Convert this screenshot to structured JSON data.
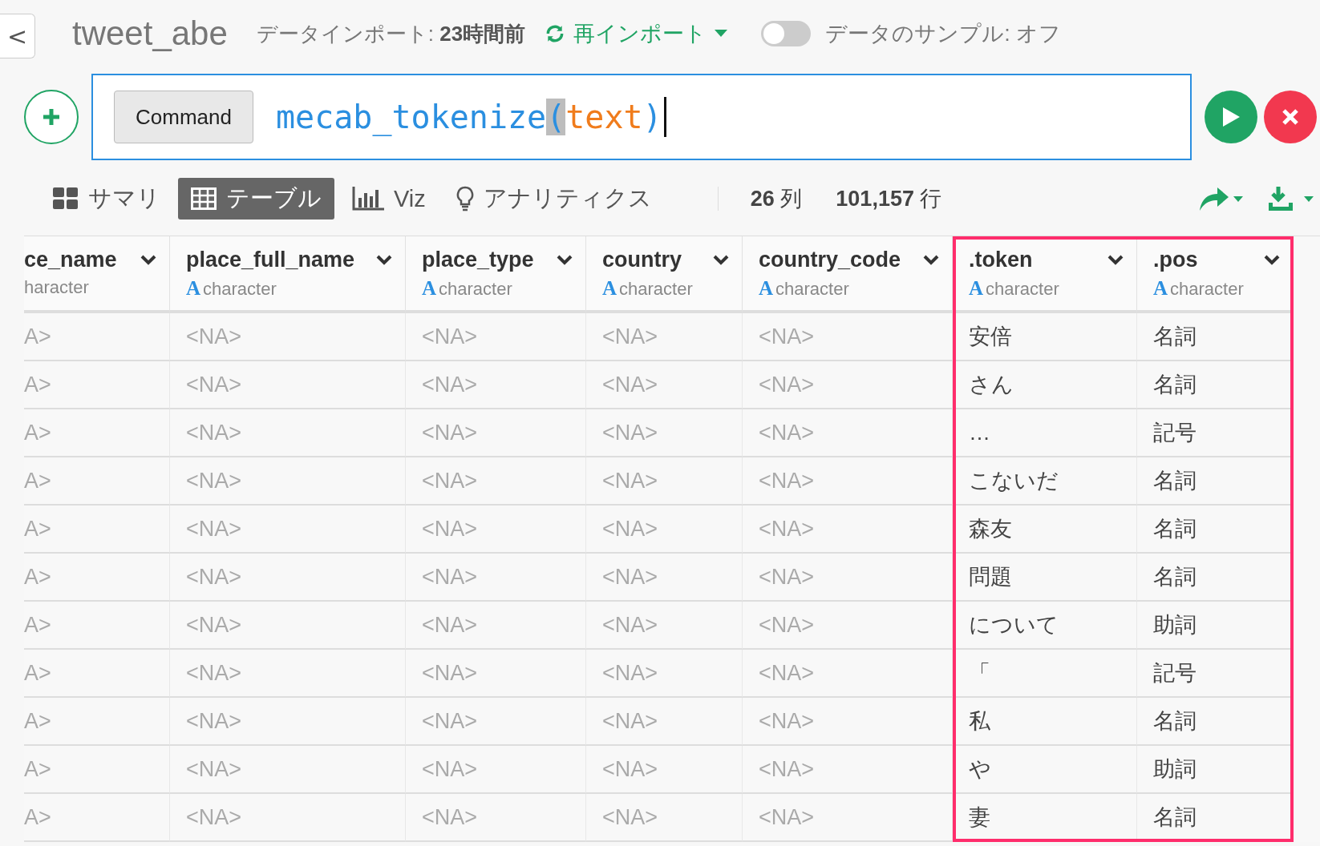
{
  "header": {
    "back": "<",
    "title": "tweet_abe",
    "import_info": "データインポート: **23時間前**",
    "reimport": "再インポート",
    "sample_toggle": {
      "on": false,
      "label": "データのサンプル: オフ"
    }
  },
  "command": {
    "button": "Command",
    "tokens": [
      {
        "text": "mecab_tokenize",
        "kind": "func",
        "highlighted": false
      },
      {
        "text": "(",
        "kind": "paren",
        "highlighted": true
      },
      {
        "text": "text",
        "kind": "arg",
        "highlighted": false
      },
      {
        "text": ")",
        "kind": "paren",
        "highlighted": false
      }
    ]
  },
  "views": [
    {
      "label": "サマリ",
      "kind": "summary",
      "selected": false
    },
    {
      "label": "テーブル",
      "kind": "table",
      "selected": true
    },
    {
      "label": "Viz",
      "kind": "viz",
      "selected": false
    },
    {
      "label": "アナリティクス",
      "kind": "analytics",
      "selected": false
    }
  ],
  "counts": {
    "columns": "**26** 列",
    "rows": "**101,157** 行"
  },
  "table": {
    "columns": [
      {
        "name": "ce_name",
        "type": "haracter",
        "missing": true,
        "highlighted": false
      },
      {
        "name": "place_full_name",
        "type": "character",
        "type_icon": "A",
        "missing": true,
        "highlighted": false
      },
      {
        "name": "place_type",
        "type": "character",
        "type_icon": "A",
        "missing": true,
        "highlighted": false
      },
      {
        "name": "country",
        "type": "character",
        "type_icon": "A",
        "missing": true,
        "highlighted": false
      },
      {
        "name": "country_code",
        "type": "character",
        "type_icon": "A",
        "missing": true,
        "highlighted": false
      },
      {
        "name": ".token",
        "type": "character",
        "type_icon": "A",
        "missing": false,
        "highlighted": true
      },
      {
        "name": ".pos",
        "type": "character",
        "type_icon": "A",
        "missing": false,
        "highlighted": true
      }
    ],
    "rows": [
      [
        "A>",
        "<NA>",
        "<NA>",
        "<NA>",
        "<NA>",
        "安倍",
        "名詞"
      ],
      [
        "A>",
        "<NA>",
        "<NA>",
        "<NA>",
        "<NA>",
        "さん",
        "名詞"
      ],
      [
        "A>",
        "<NA>",
        "<NA>",
        "<NA>",
        "<NA>",
        "…",
        "記号"
      ],
      [
        "A>",
        "<NA>",
        "<NA>",
        "<NA>",
        "<NA>",
        "こないだ",
        "名詞"
      ],
      [
        "A>",
        "<NA>",
        "<NA>",
        "<NA>",
        "<NA>",
        "森友",
        "名詞"
      ],
      [
        "A>",
        "<NA>",
        "<NA>",
        "<NA>",
        "<NA>",
        "問題",
        "名詞"
      ],
      [
        "A>",
        "<NA>",
        "<NA>",
        "<NA>",
        "<NA>",
        "について",
        "助詞"
      ],
      [
        "A>",
        "<NA>",
        "<NA>",
        "<NA>",
        "<NA>",
        "「",
        "記号"
      ],
      [
        "A>",
        "<NA>",
        "<NA>",
        "<NA>",
        "<NA>",
        "私",
        "名詞"
      ],
      [
        "A>",
        "<NA>",
        "<NA>",
        "<NA>",
        "<NA>",
        "や",
        "助詞"
      ],
      [
        "A>",
        "<NA>",
        "<NA>",
        "<NA>",
        "<NA>",
        "妻",
        "名詞"
      ]
    ]
  }
}
